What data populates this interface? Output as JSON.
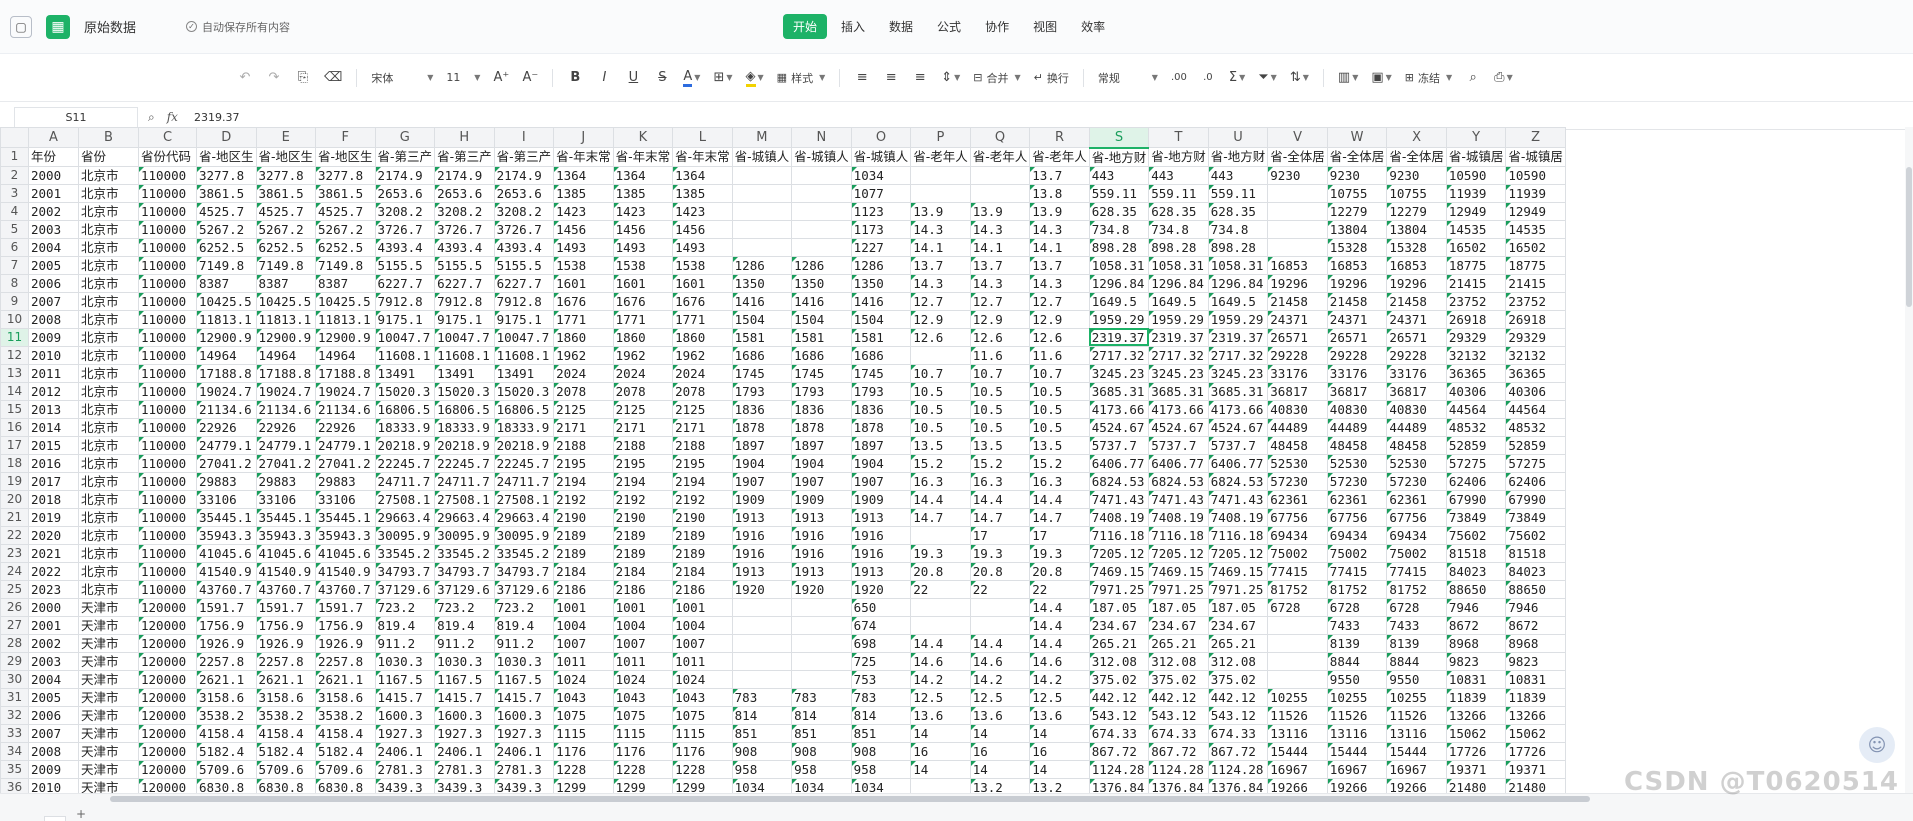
{
  "window": {
    "title": "原始数据",
    "autosave": "自动保存所有内容"
  },
  "menu_tabs": [
    "开始",
    "插入",
    "数据",
    "公式",
    "协作",
    "视图",
    "效率"
  ],
  "toolbar": {
    "font": "宋体",
    "size": "11",
    "style_label": "样式",
    "merge_label": "合并",
    "wrap_label": "换行",
    "number_format": "常规",
    "freeze_label": "冻结"
  },
  "formula_bar": {
    "cell_ref": "S11",
    "fx": "fx",
    "value": "2319.37"
  },
  "grid": {
    "selected_col": "S",
    "selected_row": 11,
    "columns": [
      "A",
      "B",
      "C",
      "D",
      "E",
      "F",
      "G",
      "H",
      "I",
      "J",
      "K",
      "L",
      "M",
      "N",
      "O",
      "P",
      "Q",
      "R",
      "S",
      "T",
      "U",
      "V",
      "W",
      "X",
      "Y",
      "Z"
    ],
    "row_numbers": [
      1,
      2,
      3,
      4,
      5,
      6,
      7,
      8,
      9,
      10,
      11,
      12,
      13,
      14,
      15,
      16,
      17,
      18,
      19,
      20,
      21,
      22,
      23,
      24,
      25,
      26,
      27,
      28,
      29,
      30,
      31,
      32,
      33,
      34,
      35,
      36
    ],
    "rows": [
      [
        "年份",
        "省份",
        "省份代码",
        "省-地区生",
        "省-地区生",
        "省-地区生",
        "省-第三产",
        "省-第三产",
        "省-第三产",
        "省-年末常",
        "省-年末常",
        "省-年末常",
        "省-城镇人",
        "省-城镇人",
        "省-城镇人",
        "省-老年人",
        "省-老年人",
        "省-老年人",
        "省-地方财",
        "省-地方财",
        "省-地方财",
        "省-全体居",
        "省-全体居",
        "省-全体居",
        "省-城镇居",
        "省-城镇居"
      ],
      [
        "2000",
        "北京市",
        "110000",
        "3277.8",
        "3277.8",
        "3277.8",
        "2174.9",
        "2174.9",
        "2174.9",
        "1364",
        "1364",
        "1364",
        "",
        "",
        "1034",
        "",
        "",
        "13.7",
        "443",
        "443",
        "443",
        "9230",
        "9230",
        "9230",
        "10590",
        "10590"
      ],
      [
        "2001",
        "北京市",
        "110000",
        "3861.5",
        "3861.5",
        "3861.5",
        "2653.6",
        "2653.6",
        "2653.6",
        "1385",
        "1385",
        "1385",
        "",
        "",
        "1077",
        "",
        "",
        "13.8",
        "559.11",
        "559.11",
        "559.11",
        "",
        "10755",
        "10755",
        "11939",
        "11939"
      ],
      [
        "2002",
        "北京市",
        "110000",
        "4525.7",
        "4525.7",
        "4525.7",
        "3208.2",
        "3208.2",
        "3208.2",
        "1423",
        "1423",
        "1423",
        "",
        "",
        "1123",
        "13.9",
        "13.9",
        "13.9",
        "628.35",
        "628.35",
        "628.35",
        "",
        "12279",
        "12279",
        "12949",
        "12949"
      ],
      [
        "2003",
        "北京市",
        "110000",
        "5267.2",
        "5267.2",
        "5267.2",
        "3726.7",
        "3726.7",
        "3726.7",
        "1456",
        "1456",
        "1456",
        "",
        "",
        "1173",
        "14.3",
        "14.3",
        "14.3",
        "734.8",
        "734.8",
        "734.8",
        "",
        "13804",
        "13804",
        "14535",
        "14535"
      ],
      [
        "2004",
        "北京市",
        "110000",
        "6252.5",
        "6252.5",
        "6252.5",
        "4393.4",
        "4393.4",
        "4393.4",
        "1493",
        "1493",
        "1493",
        "",
        "",
        "1227",
        "14.1",
        "14.1",
        "14.1",
        "898.28",
        "898.28",
        "898.28",
        "",
        "15328",
        "15328",
        "16502",
        "16502"
      ],
      [
        "2005",
        "北京市",
        "110000",
        "7149.8",
        "7149.8",
        "7149.8",
        "5155.5",
        "5155.5",
        "5155.5",
        "1538",
        "1538",
        "1538",
        "1286",
        "1286",
        "1286",
        "13.7",
        "13.7",
        "13.7",
        "1058.31",
        "1058.31",
        "1058.31",
        "16853",
        "16853",
        "16853",
        "18775",
        "18775"
      ],
      [
        "2006",
        "北京市",
        "110000",
        "8387",
        "8387",
        "8387",
        "6227.7",
        "6227.7",
        "6227.7",
        "1601",
        "1601",
        "1601",
        "1350",
        "1350",
        "1350",
        "14.3",
        "14.3",
        "14.3",
        "1296.84",
        "1296.84",
        "1296.84",
        "19296",
        "19296",
        "19296",
        "21415",
        "21415"
      ],
      [
        "2007",
        "北京市",
        "110000",
        "10425.5",
        "10425.5",
        "10425.5",
        "7912.8",
        "7912.8",
        "7912.8",
        "1676",
        "1676",
        "1676",
        "1416",
        "1416",
        "1416",
        "12.7",
        "12.7",
        "12.7",
        "1649.5",
        "1649.5",
        "1649.5",
        "21458",
        "21458",
        "21458",
        "23752",
        "23752"
      ],
      [
        "2008",
        "北京市",
        "110000",
        "11813.1",
        "11813.1",
        "11813.1",
        "9175.1",
        "9175.1",
        "9175.1",
        "1771",
        "1771",
        "1771",
        "1504",
        "1504",
        "1504",
        "12.9",
        "12.9",
        "12.9",
        "1959.29",
        "1959.29",
        "1959.29",
        "24371",
        "24371",
        "24371",
        "26918",
        "26918"
      ],
      [
        "2009",
        "北京市",
        "110000",
        "12900.9",
        "12900.9",
        "12900.9",
        "10047.7",
        "10047.7",
        "10047.7",
        "1860",
        "1860",
        "1860",
        "1581",
        "1581",
        "1581",
        "12.6",
        "12.6",
        "12.6",
        "2319.37",
        "2319.37",
        "2319.37",
        "26571",
        "26571",
        "26571",
        "29329",
        "29329"
      ],
      [
        "2010",
        "北京市",
        "110000",
        "14964",
        "14964",
        "14964",
        "11608.1",
        "11608.1",
        "11608.1",
        "1962",
        "1962",
        "1962",
        "1686",
        "1686",
        "1686",
        "",
        "11.6",
        "11.6",
        "2717.32",
        "2717.32",
        "2717.32",
        "29228",
        "29228",
        "29228",
        "32132",
        "32132"
      ],
      [
        "2011",
        "北京市",
        "110000",
        "17188.8",
        "17188.8",
        "17188.8",
        "13491",
        "13491",
        "13491",
        "2024",
        "2024",
        "2024",
        "1745",
        "1745",
        "1745",
        "10.7",
        "10.7",
        "10.7",
        "3245.23",
        "3245.23",
        "3245.23",
        "33176",
        "33176",
        "33176",
        "36365",
        "36365"
      ],
      [
        "2012",
        "北京市",
        "110000",
        "19024.7",
        "19024.7",
        "19024.7",
        "15020.3",
        "15020.3",
        "15020.3",
        "2078",
        "2078",
        "2078",
        "1793",
        "1793",
        "1793",
        "10.5",
        "10.5",
        "10.5",
        "3685.31",
        "3685.31",
        "3685.31",
        "36817",
        "36817",
        "36817",
        "40306",
        "40306"
      ],
      [
        "2013",
        "北京市",
        "110000",
        "21134.6",
        "21134.6",
        "21134.6",
        "16806.5",
        "16806.5",
        "16806.5",
        "2125",
        "2125",
        "2125",
        "1836",
        "1836",
        "1836",
        "10.5",
        "10.5",
        "10.5",
        "4173.66",
        "4173.66",
        "4173.66",
        "40830",
        "40830",
        "40830",
        "44564",
        "44564"
      ],
      [
        "2014",
        "北京市",
        "110000",
        "22926",
        "22926",
        "22926",
        "18333.9",
        "18333.9",
        "18333.9",
        "2171",
        "2171",
        "2171",
        "1878",
        "1878",
        "1878",
        "10.5",
        "10.5",
        "10.5",
        "4524.67",
        "4524.67",
        "4524.67",
        "44489",
        "44489",
        "44489",
        "48532",
        "48532"
      ],
      [
        "2015",
        "北京市",
        "110000",
        "24779.1",
        "24779.1",
        "24779.1",
        "20218.9",
        "20218.9",
        "20218.9",
        "2188",
        "2188",
        "2188",
        "1897",
        "1897",
        "1897",
        "13.5",
        "13.5",
        "13.5",
        "5737.7",
        "5737.7",
        "5737.7",
        "48458",
        "48458",
        "48458",
        "52859",
        "52859"
      ],
      [
        "2016",
        "北京市",
        "110000",
        "27041.2",
        "27041.2",
        "27041.2",
        "22245.7",
        "22245.7",
        "22245.7",
        "2195",
        "2195",
        "2195",
        "1904",
        "1904",
        "1904",
        "15.2",
        "15.2",
        "15.2",
        "6406.77",
        "6406.77",
        "6406.77",
        "52530",
        "52530",
        "52530",
        "57275",
        "57275"
      ],
      [
        "2017",
        "北京市",
        "110000",
        "29883",
        "29883",
        "29883",
        "24711.7",
        "24711.7",
        "24711.7",
        "2194",
        "2194",
        "2194",
        "1907",
        "1907",
        "1907",
        "16.3",
        "16.3",
        "16.3",
        "6824.53",
        "6824.53",
        "6824.53",
        "57230",
        "57230",
        "57230",
        "62406",
        "62406"
      ],
      [
        "2018",
        "北京市",
        "110000",
        "33106",
        "33106",
        "33106",
        "27508.1",
        "27508.1",
        "27508.1",
        "2192",
        "2192",
        "2192",
        "1909",
        "1909",
        "1909",
        "14.4",
        "14.4",
        "14.4",
        "7471.43",
        "7471.43",
        "7471.43",
        "62361",
        "62361",
        "62361",
        "67990",
        "67990"
      ],
      [
        "2019",
        "北京市",
        "110000",
        "35445.1",
        "35445.1",
        "35445.1",
        "29663.4",
        "29663.4",
        "29663.4",
        "2190",
        "2190",
        "2190",
        "1913",
        "1913",
        "1913",
        "14.7",
        "14.7",
        "14.7",
        "7408.19",
        "7408.19",
        "7408.19",
        "67756",
        "67756",
        "67756",
        "73849",
        "73849"
      ],
      [
        "2020",
        "北京市",
        "110000",
        "35943.3",
        "35943.3",
        "35943.3",
        "30095.9",
        "30095.9",
        "30095.9",
        "2189",
        "2189",
        "2189",
        "1916",
        "1916",
        "1916",
        "",
        "17",
        "17",
        "7116.18",
        "7116.18",
        "7116.18",
        "69434",
        "69434",
        "69434",
        "75602",
        "75602"
      ],
      [
        "2021",
        "北京市",
        "110000",
        "41045.6",
        "41045.6",
        "41045.6",
        "33545.2",
        "33545.2",
        "33545.2",
        "2189",
        "2189",
        "2189",
        "1916",
        "1916",
        "1916",
        "19.3",
        "19.3",
        "19.3",
        "7205.12",
        "7205.12",
        "7205.12",
        "75002",
        "75002",
        "75002",
        "81518",
        "81518"
      ],
      [
        "2022",
        "北京市",
        "110000",
        "41540.9",
        "41540.9",
        "41540.9",
        "34793.7",
        "34793.7",
        "34793.7",
        "2184",
        "2184",
        "2184",
        "1913",
        "1913",
        "1913",
        "20.8",
        "20.8",
        "20.8",
        "7469.15",
        "7469.15",
        "7469.15",
        "77415",
        "77415",
        "77415",
        "84023",
        "84023"
      ],
      [
        "2023",
        "北京市",
        "110000",
        "43760.7",
        "43760.7",
        "43760.7",
        "37129.6",
        "37129.6",
        "37129.6",
        "2186",
        "2186",
        "2186",
        "1920",
        "1920",
        "1920",
        "22",
        "22",
        "22",
        "7971.25",
        "7971.25",
        "7971.25",
        "81752",
        "81752",
        "81752",
        "88650",
        "88650"
      ],
      [
        "2000",
        "天津市",
        "120000",
        "1591.7",
        "1591.7",
        "1591.7",
        "723.2",
        "723.2",
        "723.2",
        "1001",
        "1001",
        "1001",
        "",
        "",
        "650",
        "",
        "",
        "14.4",
        "187.05",
        "187.05",
        "187.05",
        "6728",
        "6728",
        "6728",
        "7946",
        "7946"
      ],
      [
        "2001",
        "天津市",
        "120000",
        "1756.9",
        "1756.9",
        "1756.9",
        "819.4",
        "819.4",
        "819.4",
        "1004",
        "1004",
        "1004",
        "",
        "",
        "674",
        "",
        "",
        "14.4",
        "234.67",
        "234.67",
        "234.67",
        "",
        "7433",
        "7433",
        "8672",
        "8672"
      ],
      [
        "2002",
        "天津市",
        "120000",
        "1926.9",
        "1926.9",
        "1926.9",
        "911.2",
        "911.2",
        "911.2",
        "1007",
        "1007",
        "1007",
        "",
        "",
        "698",
        "14.4",
        "14.4",
        "14.4",
        "265.21",
        "265.21",
        "265.21",
        "",
        "8139",
        "8139",
        "8968",
        "8968"
      ],
      [
        "2003",
        "天津市",
        "120000",
        "2257.8",
        "2257.8",
        "2257.8",
        "1030.3",
        "1030.3",
        "1030.3",
        "1011",
        "1011",
        "1011",
        "",
        "",
        "725",
        "14.6",
        "14.6",
        "14.6",
        "312.08",
        "312.08",
        "312.08",
        "",
        "8844",
        "8844",
        "9823",
        "9823"
      ],
      [
        "2004",
        "天津市",
        "120000",
        "2621.1",
        "2621.1",
        "2621.1",
        "1167.5",
        "1167.5",
        "1167.5",
        "1024",
        "1024",
        "1024",
        "",
        "",
        "753",
        "14.2",
        "14.2",
        "14.2",
        "375.02",
        "375.02",
        "375.02",
        "",
        "9550",
        "9550",
        "10831",
        "10831"
      ],
      [
        "2005",
        "天津市",
        "120000",
        "3158.6",
        "3158.6",
        "3158.6",
        "1415.7",
        "1415.7",
        "1415.7",
        "1043",
        "1043",
        "1043",
        "783",
        "783",
        "783",
        "12.5",
        "12.5",
        "12.5",
        "442.12",
        "442.12",
        "442.12",
        "10255",
        "10255",
        "10255",
        "11839",
        "11839"
      ],
      [
        "2006",
        "天津市",
        "120000",
        "3538.2",
        "3538.2",
        "3538.2",
        "1600.3",
        "1600.3",
        "1600.3",
        "1075",
        "1075",
        "1075",
        "814",
        "814",
        "814",
        "13.6",
        "13.6",
        "13.6",
        "543.12",
        "543.12",
        "543.12",
        "11526",
        "11526",
        "11526",
        "13266",
        "13266"
      ],
      [
        "2007",
        "天津市",
        "120000",
        "4158.4",
        "4158.4",
        "4158.4",
        "1927.3",
        "1927.3",
        "1927.3",
        "1115",
        "1115",
        "1115",
        "851",
        "851",
        "851",
        "14",
        "14",
        "14",
        "674.33",
        "674.33",
        "674.33",
        "13116",
        "13116",
        "13116",
        "15062",
        "15062"
      ],
      [
        "2008",
        "天津市",
        "120000",
        "5182.4",
        "5182.4",
        "5182.4",
        "2406.1",
        "2406.1",
        "2406.1",
        "1176",
        "1176",
        "1176",
        "908",
        "908",
        "908",
        "16",
        "16",
        "16",
        "867.72",
        "867.72",
        "867.72",
        "15444",
        "15444",
        "15444",
        "17726",
        "17726"
      ],
      [
        "2009",
        "天津市",
        "120000",
        "5709.6",
        "5709.6",
        "5709.6",
        "2781.3",
        "2781.3",
        "2781.3",
        "1228",
        "1228",
        "1228",
        "958",
        "958",
        "958",
        "14",
        "14",
        "14",
        "1124.28",
        "1124.28",
        "1124.28",
        "16967",
        "16967",
        "16967",
        "19371",
        "19371"
      ],
      [
        "2010",
        "天津市",
        "120000",
        "6830.8",
        "6830.8",
        "6830.8",
        "3439.3",
        "3439.3",
        "3439.3",
        "1299",
        "1299",
        "1299",
        "1034",
        "1034",
        "1034",
        "",
        "13.2",
        "13.2",
        "1376.84",
        "1376.84",
        "1376.84",
        "19266",
        "19266",
        "19266",
        "21480",
        "21480"
      ]
    ]
  },
  "watermark": "CSDN @T0620514",
  "sheet_tab": "",
  "colors": {
    "accent": "#1db267",
    "triangle": "#1a9e5c",
    "header_bg": "#f3f4f6"
  }
}
